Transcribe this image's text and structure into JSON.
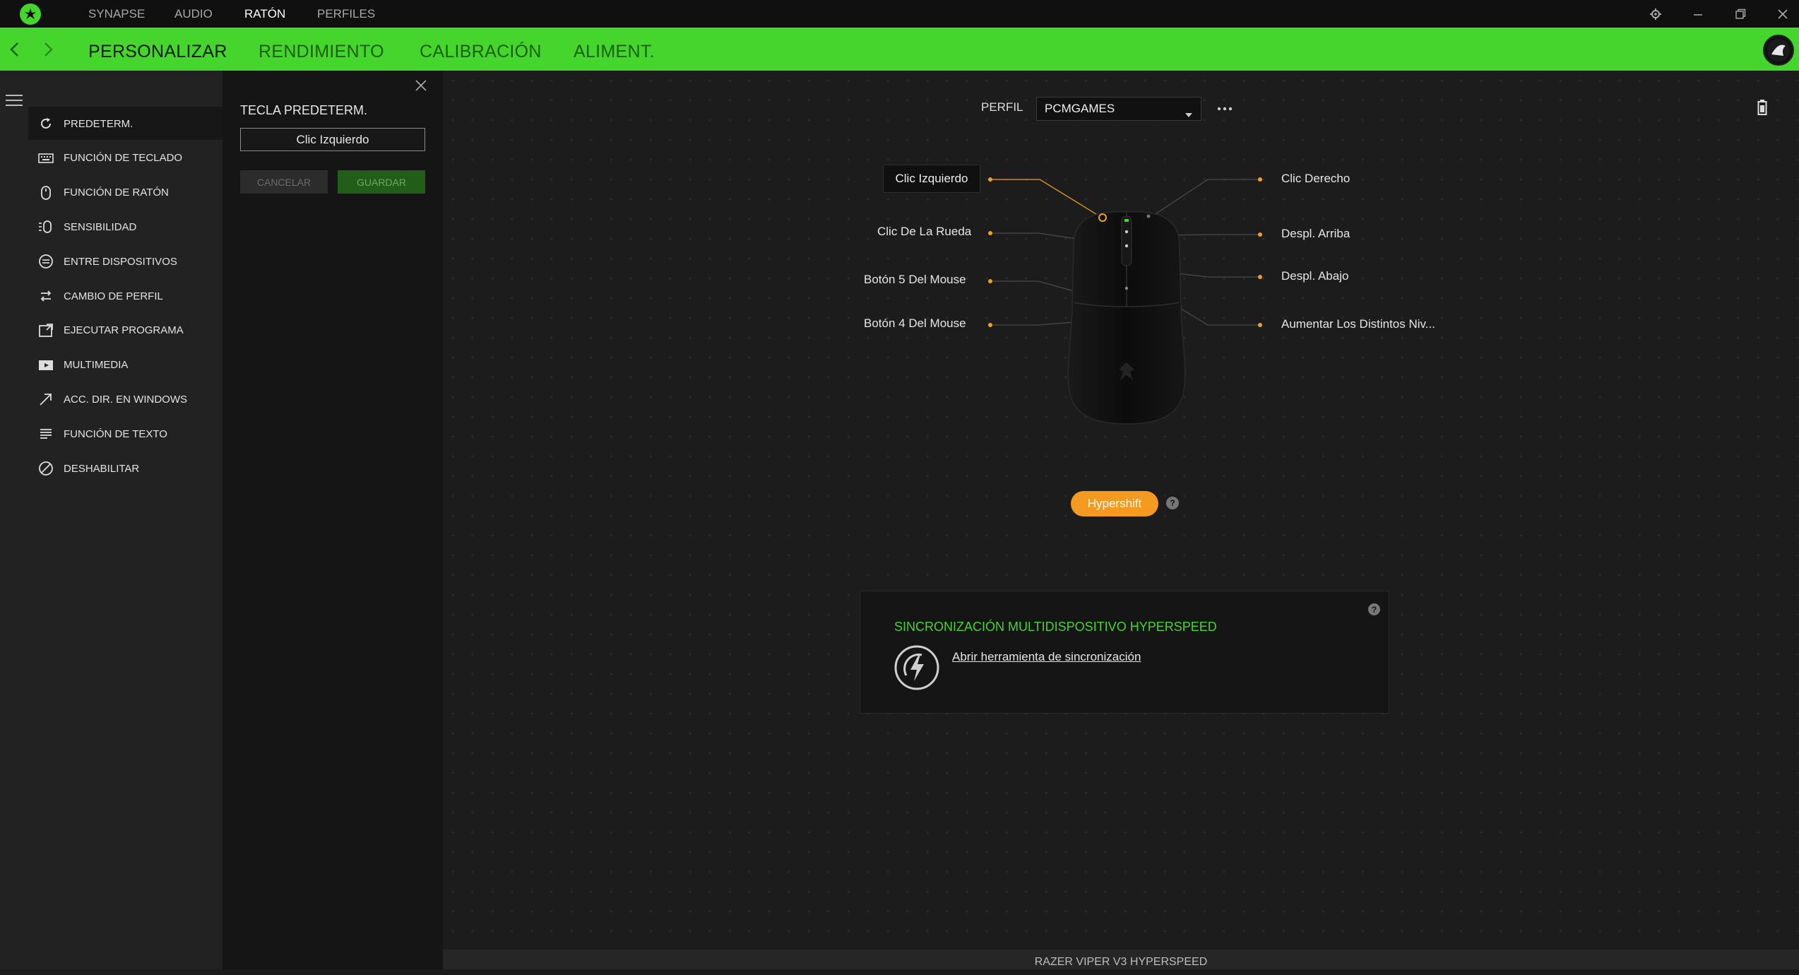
{
  "topnav": {
    "items": [
      "SYNAPSE",
      "AUDIO",
      "RATÓN",
      "PERFILES"
    ],
    "active": "RATÓN"
  },
  "tabs": {
    "items": [
      "PERSONALIZAR",
      "RENDIMIENTO",
      "CALIBRACIÓN",
      "ALIMENT."
    ],
    "active": "PERSONALIZAR"
  },
  "menu": {
    "items": [
      {
        "label": "PREDETERM.",
        "icon": "reset-icon"
      },
      {
        "label": "FUNCIÓN DE TECLADO",
        "icon": "keyboard-icon"
      },
      {
        "label": "FUNCIÓN DE RATÓN",
        "icon": "mouse-icon"
      },
      {
        "label": "SENSIBILIDAD",
        "icon": "sensitivity-icon"
      },
      {
        "label": "ENTRE DISPOSITIVOS",
        "icon": "inter-device-icon"
      },
      {
        "label": "CAMBIO DE PERFIL",
        "icon": "profile-switch-icon"
      },
      {
        "label": "EJECUTAR PROGRAMA",
        "icon": "launch-program-icon"
      },
      {
        "label": "MULTIMEDIA",
        "icon": "multimedia-icon"
      },
      {
        "label": "ACC. DIR. EN WINDOWS",
        "icon": "shortcut-arrow-icon"
      },
      {
        "label": "FUNCIÓN DE TEXTO",
        "icon": "text-icon"
      },
      {
        "label": "DESHABILITAR",
        "icon": "disable-icon"
      }
    ]
  },
  "panel": {
    "title": "TECLA PREDETERM.",
    "value": "Clic Izquierdo",
    "cancel": "CANCELAR",
    "save": "GUARDAR"
  },
  "profile": {
    "label": "PERFIL",
    "value": "PCMGAMES"
  },
  "buttons_left": [
    "Clic Izquierdo",
    "Clic De La Rueda",
    "Botón 5 Del Mouse",
    "Botón 4 Del Mouse"
  ],
  "buttons_right": [
    "Clic Derecho",
    "Despl.  Arriba",
    "Despl. Abajo",
    "Aumentar Los Distintos Niv..."
  ],
  "hypershift": "Hypershift",
  "sync": {
    "title": "SINCRONIZACIÓN MULTIDISPOSITIVO HYPERSPEED",
    "link": "Abrir herramienta de sincronización"
  },
  "device_name": "RAZER VIPER V3 HYPERSPEED",
  "colors": {
    "brand": "#44d62c",
    "accent": "#f59a20"
  }
}
